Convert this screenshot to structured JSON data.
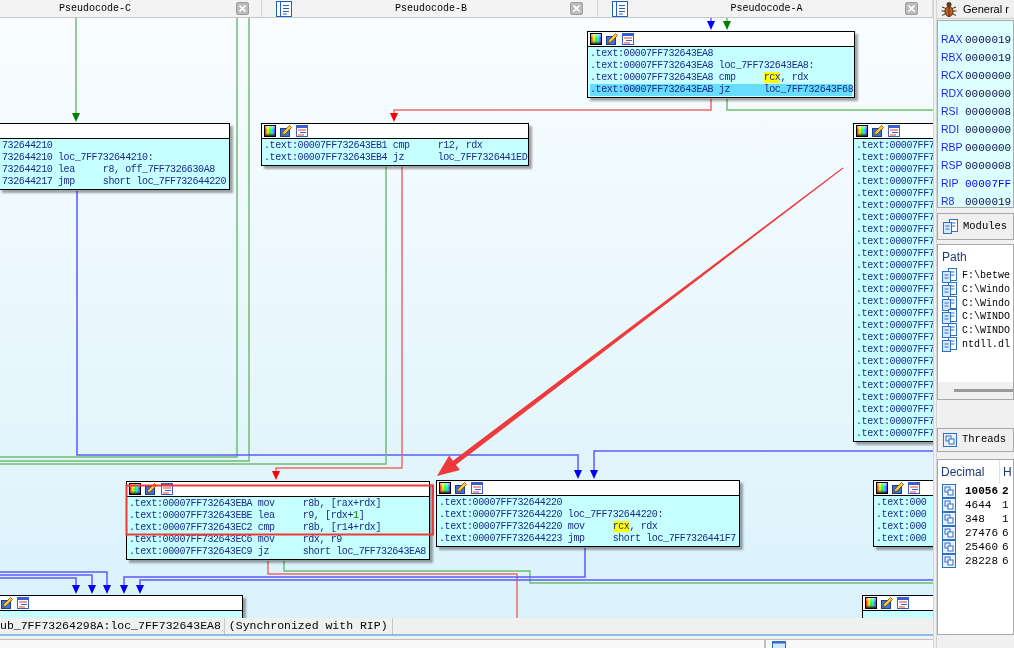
{
  "tabs": [
    {
      "label": "Pseudocode-C",
      "selected": false
    },
    {
      "label": "Pseudocode-B",
      "selected": false
    },
    {
      "label": "Pseudocode-A",
      "selected": false
    }
  ],
  "graph": {
    "blocks": [
      {
        "kind": "listing",
        "lines": [
          {
            "text": "732644210",
            "selected": false
          },
          {
            "text": "732644210 loc_7FF732644210:",
            "selected": false
          },
          {
            "text": "732644210 lea     r8, off_7FF7326630A8",
            "selected": false
          },
          {
            "text": "732644217 jmp     short loc_7FF732644220",
            "selected": false
          }
        ]
      },
      {
        "kind": "listing",
        "lines": [
          {
            "text": ".text:00007FF732643EB1 cmp     r12, rdx",
            "selected": false
          },
          {
            "text": ".text:00007FF732643EB4 jz      loc_7FF7326441ED",
            "selected": false
          }
        ]
      },
      {
        "kind": "listing",
        "lines": [
          {
            "text": ".text:00007FF732643EA8",
            "selected": false
          },
          {
            "text": ".text:00007FF732643EA8 loc_7FF732643EA8:",
            "selected": false
          },
          {
            "parts": [
              {
                "text": ".text:00007FF732643EA8 cmp     ",
                "kind": "plain"
              },
              {
                "text": "rcx",
                "kind": "highlight"
              },
              {
                "text": ", rdx",
                "kind": "plain"
              }
            ],
            "selected": false
          },
          {
            "text": ".text:00007FF732643EAB jz      loc_7FF732643F68",
            "selected": true
          }
        ]
      },
      {
        "kind": "listing",
        "lines": [
          {
            "text": ".text:00007FF7",
            "selected": false
          },
          {
            "text": ".text:00007FF7",
            "selected": false
          },
          {
            "text": ".text:00007FF7",
            "selected": false
          },
          {
            "text": ".text:00007FF7",
            "selected": false
          },
          {
            "text": ".text:00007FF7",
            "selected": false
          },
          {
            "text": ".text:00007FF7",
            "selected": false
          },
          {
            "text": ".text:00007FF7",
            "selected": false
          },
          {
            "text": ".text:00007FF7",
            "selected": false
          },
          {
            "text": ".text:00007FF7",
            "selected": false
          },
          {
            "text": ".text:00007FF7",
            "selected": false
          },
          {
            "text": ".text:00007FF7",
            "selected": false
          },
          {
            "text": ".text:00007FF7",
            "selected": false
          },
          {
            "text": ".text:00007FF7",
            "selected": false
          },
          {
            "text": ".text:00007FF7",
            "selected": false
          },
          {
            "text": ".text:00007FF7",
            "selected": false
          },
          {
            "text": ".text:00007FF7",
            "selected": false
          },
          {
            "text": ".text:00007FF7",
            "selected": false
          },
          {
            "text": ".text:00007FF7",
            "selected": false
          },
          {
            "text": ".text:00007FF7",
            "selected": false
          },
          {
            "text": ".text:00007FF7",
            "selected": false
          },
          {
            "text": ".text:00007FF7",
            "selected": false
          },
          {
            "text": ".text:00007FF7",
            "selected": false
          },
          {
            "text": ".text:00007FF7",
            "selected": false
          },
          {
            "text": ".text:00007FF7",
            "selected": false
          },
          {
            "text": ".text:00007FF7",
            "selected": false
          }
        ]
      },
      {
        "kind": "listing",
        "lines": [
          {
            "text": ".text:00007FF732643EBA mov     r8b, [rax+rdx]",
            "selected": false
          },
          {
            "parts": [
              {
                "text": ".text:00007FF732643EBE lea     r9, [rdx+",
                "kind": "plain"
              },
              {
                "text": "1",
                "kind": "number"
              },
              {
                "text": "]",
                "kind": "plain"
              }
            ],
            "selected": false
          },
          {
            "text": ".text:00007FF732643EC2 cmp     r8b, [r14+rdx]",
            "selected": false
          },
          {
            "text": ".text:00007FF732643EC6 mov     rdx, r9",
            "selected": false
          },
          {
            "text": ".text:00007FF732643EC9 jz      short loc_7FF732643EA8",
            "selected": false
          }
        ]
      },
      {
        "kind": "listing",
        "lines": [
          {
            "text": ".text:00007FF732644220",
            "selected": false
          },
          {
            "text": ".text:00007FF732644220 loc_7FF732644220:",
            "selected": false
          },
          {
            "parts": [
              {
                "text": ".text:00007FF732644220 mov     ",
                "kind": "plain"
              },
              {
                "text": "rcx",
                "kind": "highlight"
              },
              {
                "text": ", rdx",
                "kind": "plain"
              }
            ],
            "selected": false
          },
          {
            "text": ".text:00007FF732644223 jmp     short loc_7FF7326441F7",
            "selected": false
          }
        ]
      },
      {
        "kind": "listing",
        "lines": [
          {
            "text": ".text:000",
            "selected": false
          },
          {
            "text": ".text:000",
            "selected": false
          },
          {
            "text": ".text:000",
            "selected": false
          },
          {
            "text": ".text:000",
            "selected": false
          }
        ]
      },
      {
        "kind": "header_only"
      },
      {
        "kind": "header_only"
      }
    ],
    "edges": [
      {
        "kind": "true_branch"
      },
      {
        "kind": "true_branch"
      },
      {
        "kind": "true_branch"
      },
      {
        "kind": "unconditional"
      },
      {
        "kind": "unconditional"
      },
      {
        "kind": "true_branch"
      },
      {
        "kind": "false_branch"
      },
      {
        "kind": "unconditional"
      },
      {
        "kind": "true_branch"
      },
      {
        "kind": "false_branch"
      },
      {
        "kind": "true_branch"
      },
      {
        "kind": "false_branch"
      },
      {
        "kind": "true_branch"
      },
      {
        "kind": "unconditional"
      },
      {
        "kind": "unconditional"
      },
      {
        "kind": "unconditional"
      },
      {
        "kind": "unconditional"
      },
      {
        "kind": "unconditional"
      }
    ]
  },
  "status_bar": {
    "location": "ub_7FF73264298A:loc_7FF732643EA8",
    "sync": "(Synchronized with RIP)"
  },
  "registers_panel": {
    "title": "General r",
    "registers": [
      {
        "name": "RAX",
        "value": "0000019",
        "changed": false
      },
      {
        "name": "RBX",
        "value": "0000019",
        "changed": false
      },
      {
        "name": "RCX",
        "value": "0000000",
        "changed": false
      },
      {
        "name": "RDX",
        "value": "0000000",
        "changed": false
      },
      {
        "name": "RSI",
        "value": "0000008",
        "changed": false
      },
      {
        "name": "RDI",
        "value": "0000000",
        "changed": false
      },
      {
        "name": "RBP",
        "value": "0000000",
        "changed": false
      },
      {
        "name": "RSP",
        "value": "0000008",
        "changed": false
      },
      {
        "name": "RIP",
        "value": "00007FF",
        "changed": true
      },
      {
        "name": "R8",
        "value": "0000019",
        "changed": false
      }
    ]
  },
  "modules_panel": {
    "title": "Modules",
    "column": "Path",
    "rows": [
      "F:\\betwe",
      "C:\\Windo",
      "C:\\Windo",
      "C:\\WINDO",
      "C:\\WINDO",
      "ntdll.dl"
    ]
  },
  "threads_panel": {
    "title": "Threads",
    "columns": [
      "Decimal",
      "H"
    ],
    "rows": [
      {
        "decimal": "10056",
        "hex": "2",
        "current": true
      },
      {
        "decimal": "4644",
        "hex": "1",
        "current": false
      },
      {
        "decimal": "348",
        "hex": "1",
        "current": false
      },
      {
        "decimal": "27476",
        "hex": "6",
        "current": false
      },
      {
        "decimal": "25460",
        "hex": "6",
        "current": false
      },
      {
        "decimal": "28228",
        "hex": "6",
        "current": false
      }
    ]
  }
}
